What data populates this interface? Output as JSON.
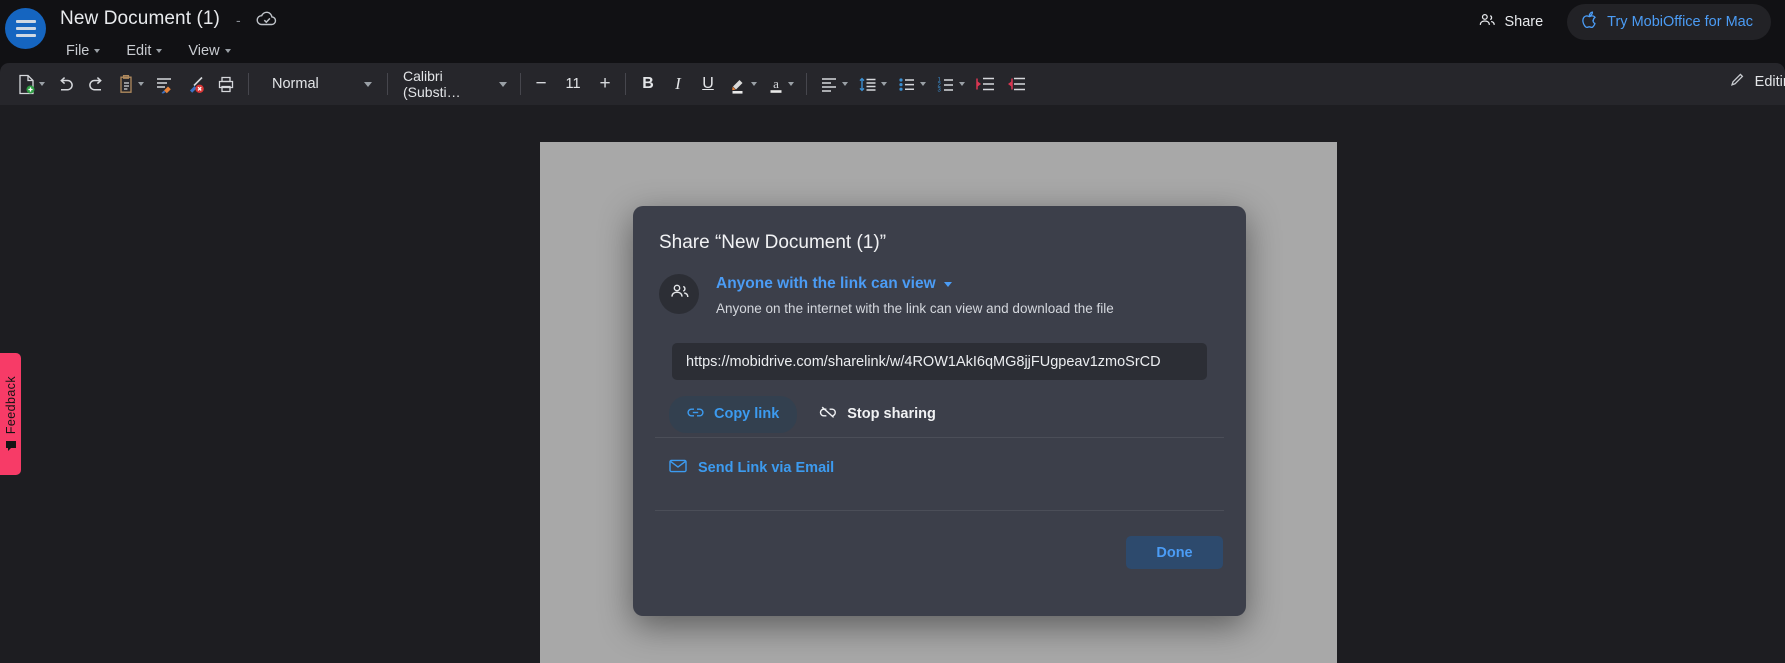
{
  "app": {
    "document_title": "New Document (1)",
    "title_separator": "-",
    "cloud_status_icon": "cloud-check-icon"
  },
  "menubar": {
    "items": [
      {
        "label": "File",
        "name": "menu-file"
      },
      {
        "label": "Edit",
        "name": "menu-edit"
      },
      {
        "label": "View",
        "name": "menu-view"
      }
    ]
  },
  "topbar_right": {
    "share_label": "Share",
    "share_icon": "people-icon",
    "promo_label": "Try MobiOffice for Mac",
    "promo_icon": "apple-icon"
  },
  "toolbar": {
    "new_doc_icon": "new-document-icon",
    "undo_icon": "undo-arrow-icon",
    "redo_icon": "redo-arrow-icon",
    "paste_icon": "clipboard-paste-icon",
    "format_painter_icon": "format-painter-icon",
    "clear_format_icon": "clear-formatting-icon",
    "print_icon": "printer-icon",
    "paragraph_style": "Normal",
    "font_family": "Calibri (Substi…",
    "font_size": "11",
    "decrease_font_label": "−",
    "increase_font_label": "+",
    "bold_label": "B",
    "italic_label": "I",
    "underline_label": "U",
    "highlight_icon": "text-highlight-icon",
    "font_color_icon": "font-color-icon",
    "align_icon": "align-left-icon",
    "line_spacing_icon": "line-spacing-icon",
    "bullet_list_icon": "bullet-list-icon",
    "numbered_list_icon": "numbered-list-icon",
    "decrease_indent_icon": "decrease-indent-icon",
    "increase_indent_icon": "increase-indent-icon",
    "editing_mode_label": "Editing",
    "editing_mode_icon": "pencil-icon"
  },
  "feedback": {
    "label": "Feedback",
    "icon": "feedback-icon",
    "color": "#f73b67"
  },
  "share_dialog": {
    "title": "Share “New Document (1)”",
    "avatar_icon": "people-icon",
    "permission_label": "Anyone with the link can view",
    "permission_description": "Anyone on the internet with the link can view and download the file",
    "link_url": "https://mobidrive.com/sharelink/w/4ROW1AkI6qMG8jjFUgpeav1zmoSrCD",
    "copy_link_label": "Copy link",
    "copy_link_icon": "link-icon",
    "stop_sharing_label": "Stop sharing",
    "stop_sharing_icon": "broken-link-icon",
    "send_email_label": "Send Link via Email",
    "send_email_icon": "envelope-icon",
    "done_label": "Done",
    "accent_color": "#4b9cf5"
  }
}
